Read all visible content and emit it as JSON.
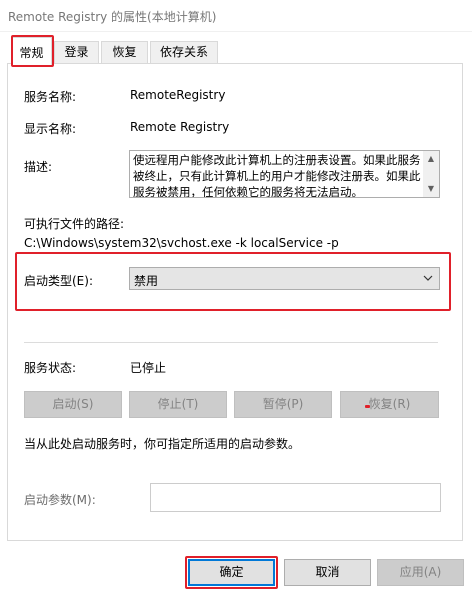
{
  "window": {
    "title": "Remote Registry 的属性(本地计算机)"
  },
  "tabs": [
    {
      "label": "常规"
    },
    {
      "label": "登录"
    },
    {
      "label": "恢复"
    },
    {
      "label": "依存关系"
    }
  ],
  "general": {
    "service_name_label": "服务名称:",
    "service_name_value": "RemoteRegistry",
    "display_name_label": "显示名称:",
    "display_name_value": "Remote Registry",
    "description_label": "描述:",
    "description_value": "使远程用户能修改此计算机上的注册表设置。如果此服务被终止，只有此计算机上的用户才能修改注册表。如果此服务被禁用，任何依赖它的服务将无法启动。",
    "exe_path_label": "可执行文件的路径:",
    "exe_path_value": "C:\\Windows\\system32\\svchost.exe -k localService -p",
    "startup_type_label": "启动类型(E):",
    "startup_type_value": "禁用",
    "status_label": "服务状态:",
    "status_value": "已停止",
    "btn_start": "启动(S)",
    "btn_stop": "停止(T)",
    "btn_pause": "暂停(P)",
    "btn_resume": "恢复(R)",
    "hint": "当从此处启动服务时，你可指定所适用的启动参数。",
    "params_label": "启动参数(M):",
    "params_value": ""
  },
  "footer": {
    "ok": "确定",
    "cancel": "取消",
    "apply": "应用(A)"
  },
  "colors": {
    "highlight_box": "#e0202a",
    "focus_border": "#0078d7"
  }
}
